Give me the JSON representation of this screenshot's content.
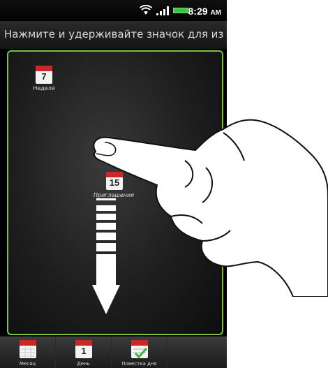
{
  "status_bar": {
    "time": "8:29",
    "ampm": "AM",
    "icons": [
      "wifi-icon",
      "signal-icon",
      "battery-icon"
    ],
    "battery_color": "#3fc43f"
  },
  "hint": {
    "text": "Нажмите и удерживайте значок для из"
  },
  "widgets": {
    "week": {
      "label": "Неделя",
      "number": "7"
    },
    "invites": {
      "label": "Приглашения",
      "number": "15"
    }
  },
  "dock": {
    "items": [
      {
        "label": "Месяц",
        "number": "",
        "icon": "calendar-month-icon"
      },
      {
        "label": "День",
        "number": "1",
        "icon": "calendar-day-icon"
      },
      {
        "label": "Повестка дня",
        "number": "",
        "icon": "agenda-icon"
      }
    ]
  },
  "colors": {
    "accent_border": "#7bc043",
    "calendar_red": "#c8282a"
  }
}
